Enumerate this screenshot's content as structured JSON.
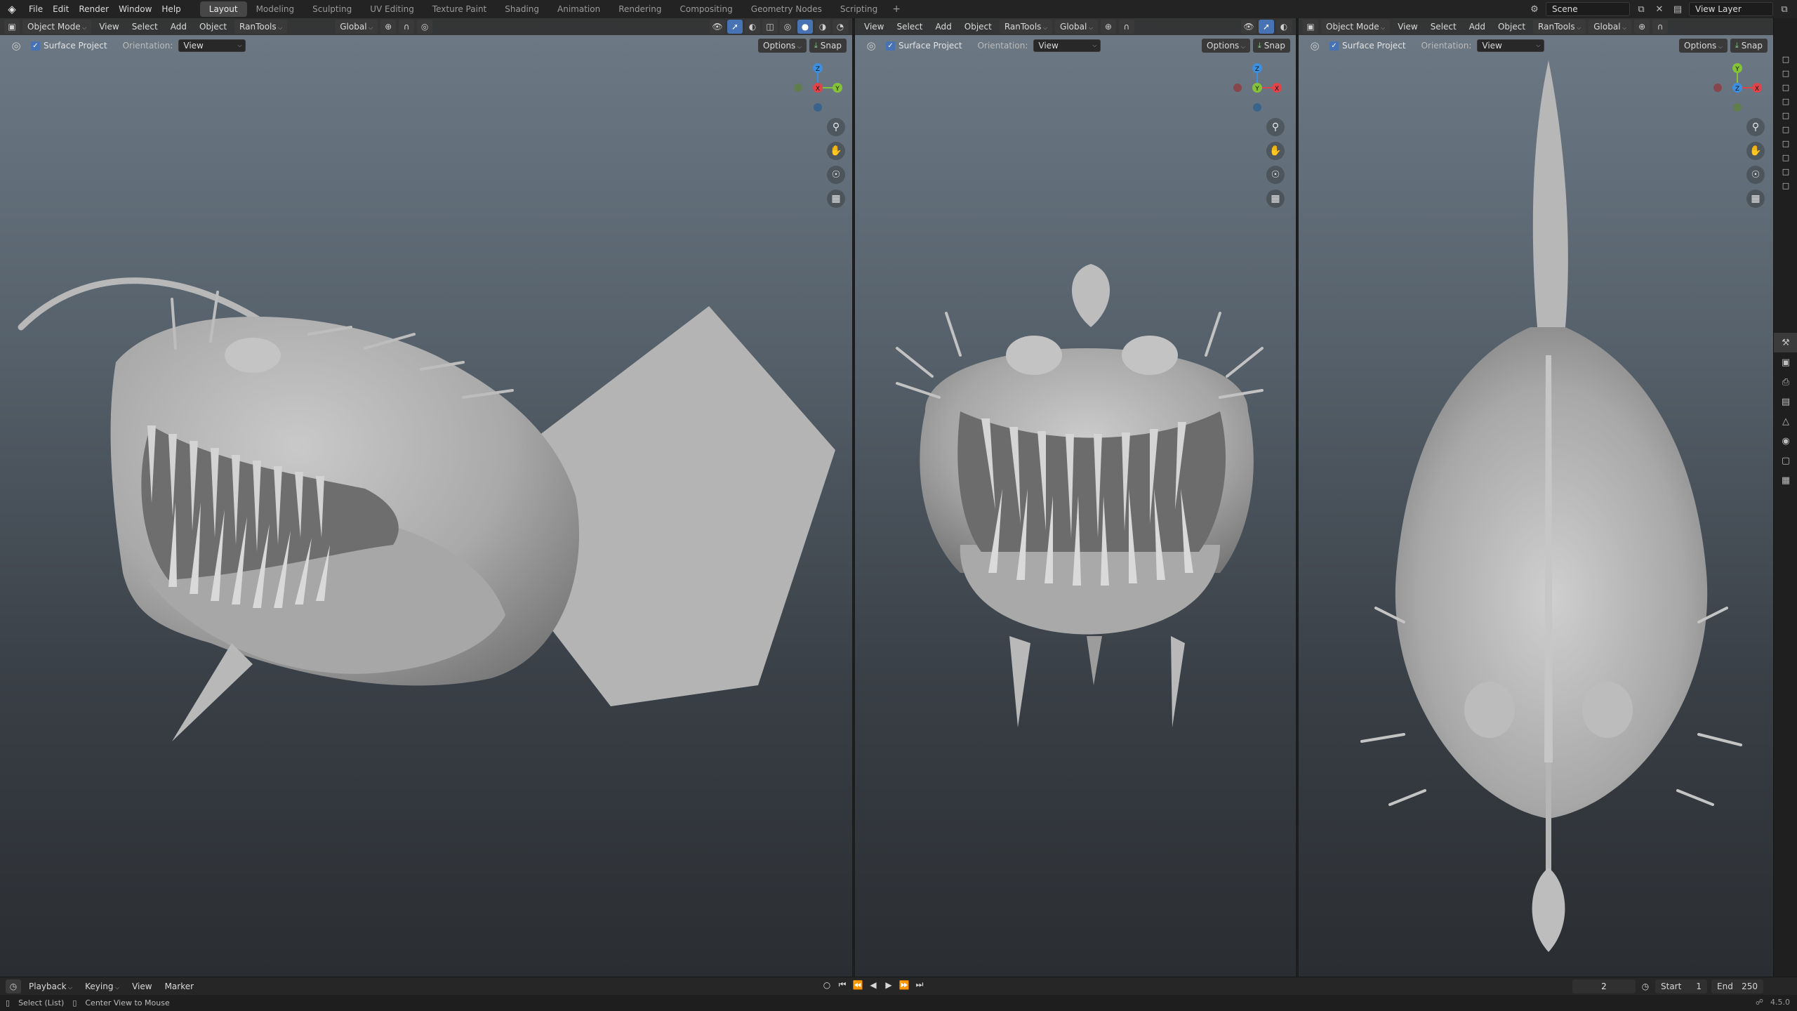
{
  "menu": {
    "items": [
      "File",
      "Edit",
      "Render",
      "Window",
      "Help"
    ]
  },
  "workspaces": {
    "tabs": [
      "Layout",
      "Modeling",
      "Sculpting",
      "UV Editing",
      "Texture Paint",
      "Shading",
      "Animation",
      "Rendering",
      "Compositing",
      "Geometry Nodes",
      "Scripting"
    ],
    "active": "Layout",
    "add": "+"
  },
  "topright": {
    "scene": "Scene",
    "view_layer": "View Layer"
  },
  "viewport_header": {
    "mode": "Object Mode",
    "view": "View",
    "select": "Select",
    "add": "Add",
    "object": "Object",
    "addon": "RanTools",
    "orientation": "Global"
  },
  "tool_header": {
    "surface_project": "Surface Project",
    "orientation_label": "Orientation:",
    "orientation_value": "View",
    "options": "Options",
    "snap": "Snap"
  },
  "gizmo_axes": {
    "x": "X",
    "y": "Y",
    "z": "Z"
  },
  "timeline": {
    "playback": "Playback",
    "keying": "Keying",
    "view": "View",
    "marker": "Marker",
    "current_frame": "2",
    "start_label": "Start",
    "start": "1",
    "end_label": "End",
    "end": "250"
  },
  "status": {
    "select_hint": "Select (List)",
    "center_hint": "Center View to Mouse",
    "version": "4.5.0"
  },
  "colors": {
    "axis_x": "#e0434a",
    "axis_y": "#84c23a",
    "axis_z": "#3d8fe0",
    "accent": "#4772b3"
  }
}
